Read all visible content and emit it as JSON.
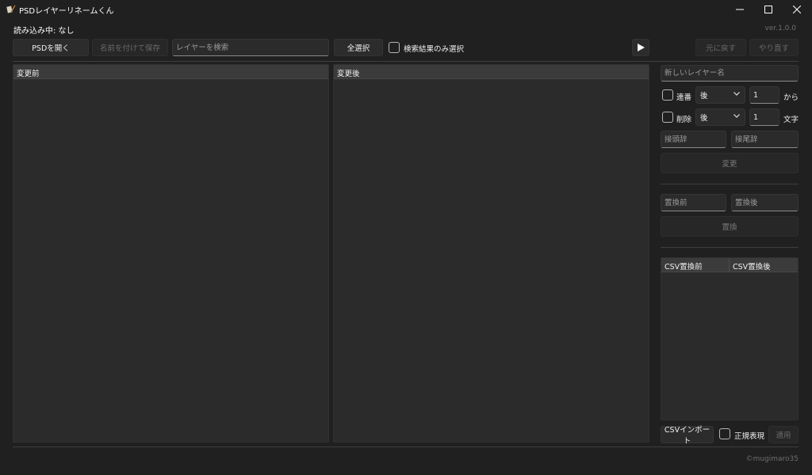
{
  "window": {
    "title": "PSDレイヤーリネームくん"
  },
  "status": {
    "loading": "読み込み中: なし",
    "version": "ver.1.0.0"
  },
  "toolbar": {
    "open_psd": "PSDを開く",
    "save_as": "名前を付けて保存",
    "search_placeholder": "レイヤーを検索",
    "select_all": "全選択",
    "search_only_label": "検索結果のみ選択",
    "undo": "元に戻す",
    "redo": "やり直す"
  },
  "panels": {
    "before_header": "変更前",
    "after_header": "変更後"
  },
  "rename": {
    "new_name_placeholder": "新しいレイヤー名",
    "sequence_label": "連番",
    "sequence_position": "後",
    "sequence_start": "1",
    "sequence_suffix": "から",
    "delete_label": "削除",
    "delete_position": "後",
    "delete_count": "1",
    "delete_suffix": "文字",
    "prefix_placeholder": "接頭辞",
    "suffix_placeholder": "接尾辞",
    "change_button": "変更"
  },
  "replace": {
    "before_placeholder": "置換前",
    "after_placeholder": "置換後",
    "replace_button": "置換"
  },
  "csv": {
    "col_before": "CSV置換前",
    "col_after": "CSV置換後",
    "import_button": "CSVインポート",
    "regex_label": "正規表現",
    "apply_button": "適用"
  },
  "footer": {
    "copyright": "©mugimaro35"
  }
}
